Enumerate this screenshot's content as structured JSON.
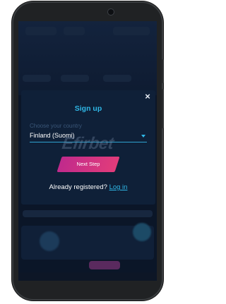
{
  "modal": {
    "title": "Sign up",
    "country_label": "Choose your country",
    "country_value": "Finland (Suomi)",
    "next_button": "Next Step",
    "already_text": "Already registered?",
    "login_link": "Log in",
    "close_symbol": "×"
  },
  "watermark_text": "Efirbet",
  "icons": [
    "close-icon",
    "chevron-down-icon",
    "camera-icon"
  ],
  "colors": {
    "accent": "#2fb7e6",
    "button_gradient_start": "#c02a8c",
    "button_gradient_end": "#e23c7a",
    "modal_bg": "#0f2038",
    "screen_bg": "#0b1628"
  }
}
